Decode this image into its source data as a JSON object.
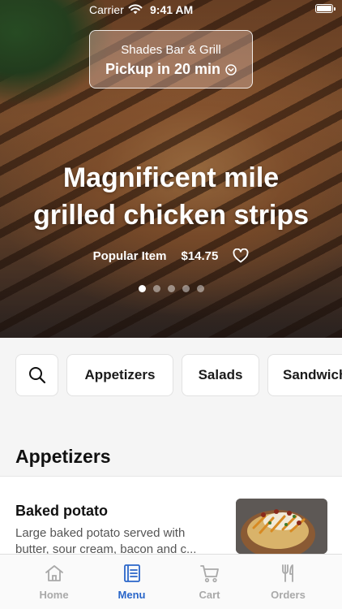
{
  "status_bar": {
    "carrier": "Carrier",
    "time": "9:41 AM"
  },
  "pickup": {
    "restaurant": "Shades Bar & Grill",
    "time_label": "Pickup in 20 min"
  },
  "hero": {
    "title_line1": "Magnificent mile",
    "title_line2": "grilled chicken strips",
    "badge": "Popular Item",
    "price": "$14.75",
    "slides_total": 5,
    "slide_active": 1
  },
  "categories": [
    "Appetizers",
    "Salads",
    "Sandwiches"
  ],
  "section": {
    "title": "Appetizers",
    "items": [
      {
        "name": "Baked potato",
        "desc_line1": "Large baked potato served with",
        "desc_line2": "butter, sour cream, bacon and c..."
      }
    ]
  },
  "tabs": [
    {
      "label": "Home",
      "icon": "home-icon"
    },
    {
      "label": "Menu",
      "icon": "menu-icon"
    },
    {
      "label": "Cart",
      "icon": "cart-icon"
    },
    {
      "label": "Orders",
      "icon": "utensils-icon"
    }
  ],
  "colors": {
    "accent": "#2a66c9",
    "inactive_tab": "#a9a9a9"
  }
}
